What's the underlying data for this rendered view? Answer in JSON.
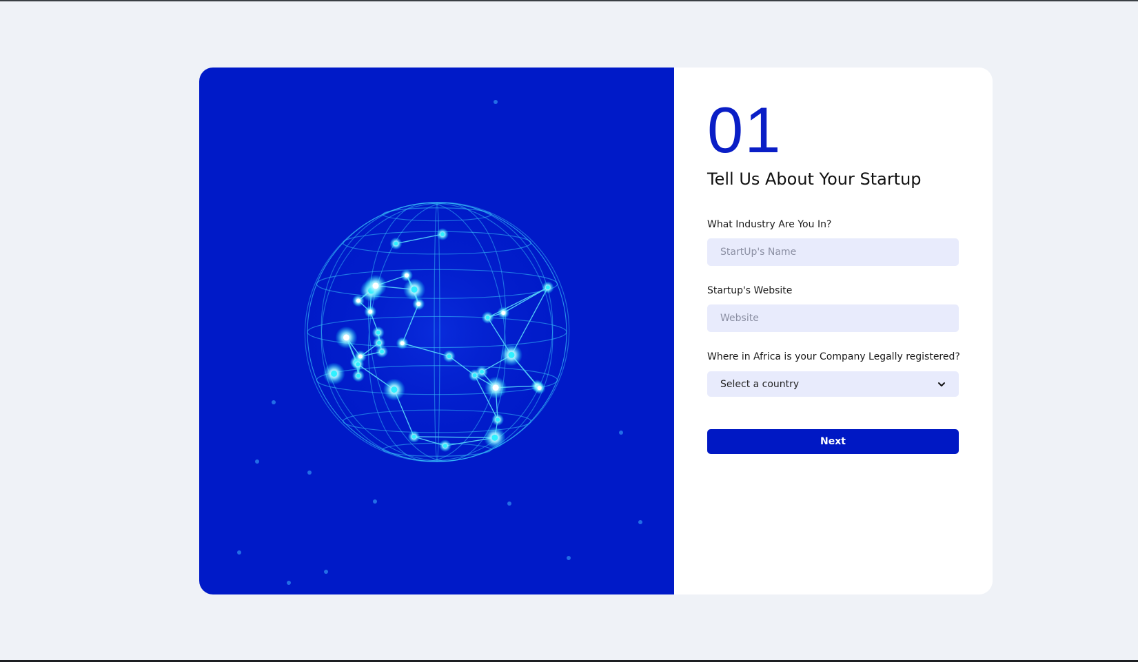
{
  "form": {
    "step_number": "01",
    "title": "Tell Us About Your Startup",
    "fields": [
      {
        "label": "What Industry Are You In?",
        "placeholder": "StartUp's Name",
        "value": ""
      },
      {
        "label": "Startup's Website",
        "placeholder": "Website",
        "value": ""
      },
      {
        "label": "Where in Africa is your Company Legally registered?",
        "selected": "Select a country"
      }
    ],
    "next_label": "Next"
  },
  "colors": {
    "page_bg": "#eff2f7",
    "hero_bg": "#001ac8",
    "accent": "#0018c4",
    "input_bg": "#e8ebfc"
  },
  "icons": {
    "hero": "network-globe-icon",
    "select": "chevron-down-icon"
  }
}
